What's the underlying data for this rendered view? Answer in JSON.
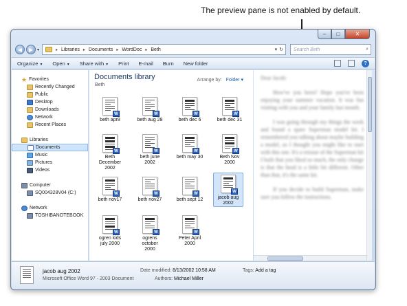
{
  "callout": {
    "text": "The preview pane is not enabled by default."
  },
  "window": {
    "minimize": "–",
    "maximize": "□",
    "close": "✕"
  },
  "address": {
    "back": "◀",
    "forward": "▶",
    "history": "▾",
    "crumbs": [
      "Libraries",
      "Documents",
      "WordDoc",
      "Beth"
    ],
    "separator": "▸",
    "dropdown": "▾",
    "refresh": "↻",
    "search_placeholder": "Search Beth",
    "search_icon": "⌕"
  },
  "toolbar": {
    "organize": "Organize",
    "open": "Open",
    "share_with": "Share with",
    "print": "Print",
    "email": "E-mail",
    "burn": "Burn",
    "new_folder": "New folder",
    "help": "?"
  },
  "nav": {
    "favorites": "Favorites",
    "fav_items": [
      "Recently Changed",
      "Public",
      "Desktop",
      "Downloads",
      "Network",
      "Recent Places"
    ],
    "libraries": "Libraries",
    "lib_items": [
      "Documents",
      "Music",
      "Pictures",
      "Videos"
    ],
    "computer": "Computer",
    "computer_items": [
      "SQ004328V04 (C:)"
    ],
    "network": "Network",
    "network_items": [
      "TOSHIBANOTEBOOK"
    ]
  },
  "library": {
    "title": "Documents library",
    "subtitle": "Beth",
    "arrange_label": "Arrange by:",
    "arrange_value": "Folder ▾"
  },
  "files": [
    "beth apr8",
    "beth aug 28",
    "beth dec 6",
    "beth dec 31",
    "Beth\nDecember\n2002",
    "beth june\n2002",
    "beth may 30",
    "Beth Nov\n2000",
    "beth nov17",
    "beth nov27",
    "beth sept 12",
    "jacob aug\n2002",
    "ogren kids\njuly 2000",
    "ogrens\noctober\n2000",
    "Peter April\n2000"
  ],
  "preview": {
    "paragraphs": [
      "Dear Jacob:",
      "How've you been? Hope you've been enjoying your summer vacation. It was fun visiting with you and your family last month.",
      "I was going through my things the week and found a spare Superman model kit. I remembered you talking about maybe building a model, so I thought you might like to start with this one. It's a reissue of the Superman kit I built that you liked so much, the only change is that the head is a little bit different. Other than that, it's the same kit.",
      "If you decide to build Superman, make sure you follow the instructions."
    ]
  },
  "details": {
    "name": "jacob aug 2002",
    "type": "Microsoft Office Word 97 - 2003 Document",
    "modified_label": "Date modified:",
    "modified_value": "8/13/2002 10:58 AM",
    "authors_label": "Authors:",
    "authors_value": "Michael Miller",
    "tags_label": "Tags:",
    "tags_value": "Add a tag"
  }
}
